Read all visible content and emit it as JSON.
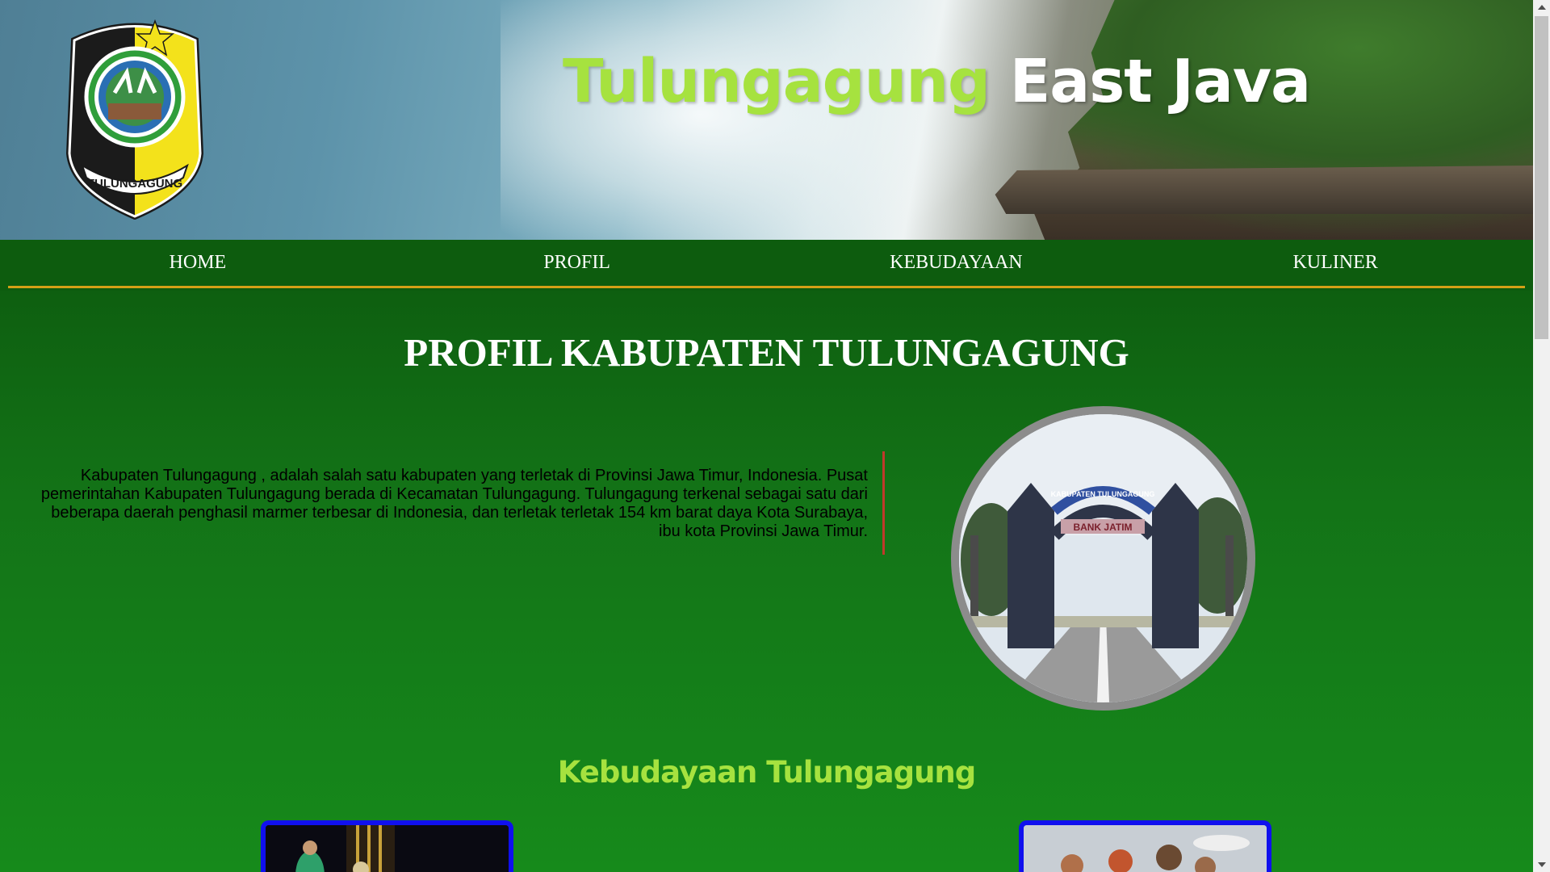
{
  "header": {
    "title_part1": "Tulungagung",
    "title_part2": "East Java",
    "logo_text": "TULUNGAGUNG",
    "logo_icon": "regency-emblem-icon",
    "accent_color": "#a6e23f"
  },
  "nav": {
    "items": [
      {
        "label": "HOME"
      },
      {
        "label": "PROFIL"
      },
      {
        "label": "KEBUDAYAAN"
      },
      {
        "label": "KULINER"
      }
    ],
    "underline_color": "#d4a017"
  },
  "main": {
    "page_title": "PROFIL KABUPATEN TULUNGAGUNG",
    "profile_text": "Kabupaten Tulungagung , adalah salah satu kabupaten yang terletak di Provinsi Jawa Timur, Indonesia. Pusat pemerintahan Kabupaten Tulungagung berada di Kecamatan Tulungagung. Tulungagung terkenal sebagai satu dari beberapa daerah penghasil marmer terbesar di Indonesia, dan terletak terletak 154 km barat daya Kota Surabaya, ibu kota Provinsi Jawa Timur.",
    "gate_sign_top": "KABUPATEN TULUNGAGUNG",
    "gate_sign_bank": "BANK JATIM",
    "section_title": "Kebudayaan Tulungagung",
    "card_border_color": "#1010ee"
  }
}
